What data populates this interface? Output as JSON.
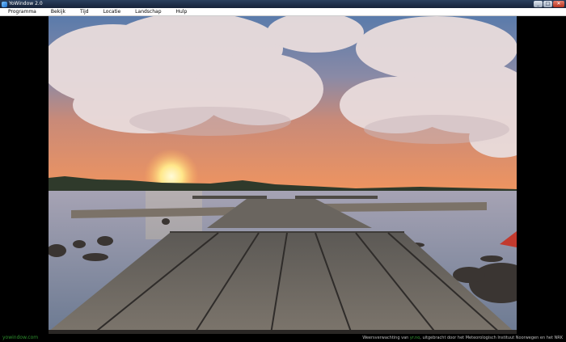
{
  "window": {
    "title": "YoWindow 2.0",
    "controls": {
      "minimize": "_",
      "maximize": "□",
      "close": "✕"
    }
  },
  "menu": {
    "items": [
      "Programma",
      "Bekijk",
      "Tijd",
      "Locatie",
      "Landschap",
      "Hulp"
    ]
  },
  "footer": {
    "site_link": "yowindow.com",
    "credit_prefix": "Weersverwachting van ",
    "credit_link": "yr.no",
    "credit_suffix": ", uitgebracht door het Meteorologisch Instituut Noorwegen en het NRK"
  },
  "scene": {
    "sky_top": "#6f84a4",
    "sky_bottom": "#e8905e",
    "water": "#8c98ac",
    "sun": "#fff4b0",
    "dock_wood": "#6f6a64"
  }
}
